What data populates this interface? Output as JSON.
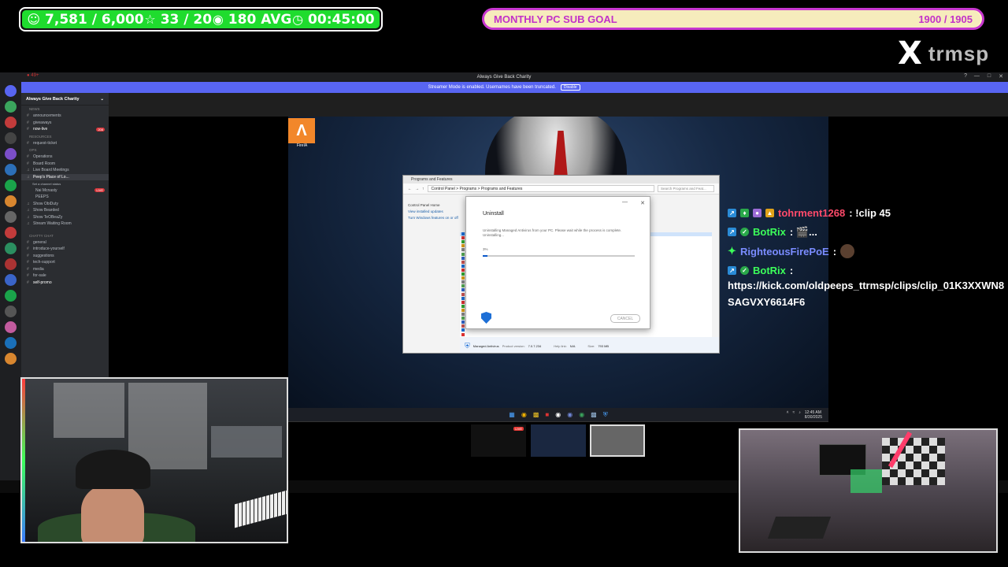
{
  "stream_stats": {
    "followers": "7,581 / 6,000",
    "favorites": "33 / 20",
    "viewers": "180 AVG",
    "timer": "00:45:00",
    "icons": {
      "followers": "user-icon",
      "favorites": "star-icon",
      "viewers": "eye-icon",
      "timer": "clock-icon"
    },
    "accent": "#1fdc2e"
  },
  "sub_goal": {
    "label": "MONTHLY PC SUB GOAL",
    "value": "1900 / 1905",
    "progress": 0.997,
    "accent": "#c837d0"
  },
  "logo": {
    "mark": "X",
    "name": "trmsp"
  },
  "discord": {
    "window_title": "Always Give Back Charity",
    "streamer_mode_text": "Streamer Mode is enabled. Usernames have been truncated.",
    "disable_label": "Disable",
    "server_name": "Always Give Back Charity",
    "categories": {
      "news": "NEWS",
      "resources": "RESOURCES",
      "ops": "OPS",
      "chatty": "CHATTY CHAT"
    },
    "channels": [
      {
        "name": "announcements"
      },
      {
        "name": "giveaways"
      },
      {
        "name": "now-live",
        "badge": "208"
      },
      {
        "name": "request-ticket"
      },
      {
        "name": "Operations"
      },
      {
        "name": "Board Room"
      },
      {
        "name": "Live Board Meetings"
      },
      {
        "name": "Peep's Place of Lo..."
      },
      {
        "name": "Set a channel status"
      },
      {
        "name": "Nai Mcnasty",
        "badge": "LIVE"
      },
      {
        "name": "PEEPS"
      },
      {
        "name": "Show ObiDuty"
      },
      {
        "name": "Show Bearded"
      },
      {
        "name": "Show TeOBeaZy"
      },
      {
        "name": "Stream Waiting Room"
      },
      {
        "name": "general"
      },
      {
        "name": "introduce-yourself"
      },
      {
        "name": "suggestions"
      },
      {
        "name": "tech-support"
      },
      {
        "name": "media"
      },
      {
        "name": "for-sale"
      },
      {
        "name": "self-promo"
      }
    ],
    "accent": "#5865f2"
  },
  "desktop": {
    "icon_label": "FireIA",
    "programs_window": {
      "title": "Programs and Features",
      "breadcrumb": "Control Panel  >  Programs  >  Programs and Features",
      "search_placeholder": "Search Programs and Feat...",
      "side_links": [
        "Control Panel Home",
        "View installed updates",
        "Turn Windows features on or off"
      ],
      "bottom_name": "Managed Antivirus",
      "bottom_version_label": "Product version:",
      "bottom_version": "7.0.7.234",
      "bottom_help_label": "Help link:",
      "bottom_help": "N/A",
      "bottom_size_label": "Size:",
      "bottom_size": "793 MB"
    },
    "dialog": {
      "title": "Uninstall",
      "message": "Uninstalling Managed Antivirus from your PC. Please wait while the process is complete.",
      "status": "Uninstalling...",
      "percent": "3%",
      "progress": 0.03,
      "cancel_label": "CANCEL"
    },
    "tray_time": "12:45 AM",
    "tray_date": "8/30/2025"
  },
  "scene_switcher": {
    "live_badge": "LIVE"
  },
  "chat": [
    {
      "user": "tohrment1268",
      "color": "#ff4a6a",
      "text": ": !clip 45"
    },
    {
      "user": "BotRix",
      "color": "#3cff5a",
      "text": ": 🎬..."
    },
    {
      "user": "RighteousFirePoE",
      "color": "#7a8cff",
      "text": ":"
    },
    {
      "user": "BotRix",
      "color": "#3cff5a",
      "text": ":"
    }
  ],
  "chat_url_line1": "https://kick.com/oldpeeps_ttrmsp/clips/clip_01K3XXWN8",
  "chat_url_line2": "SAGVXY6614F6"
}
